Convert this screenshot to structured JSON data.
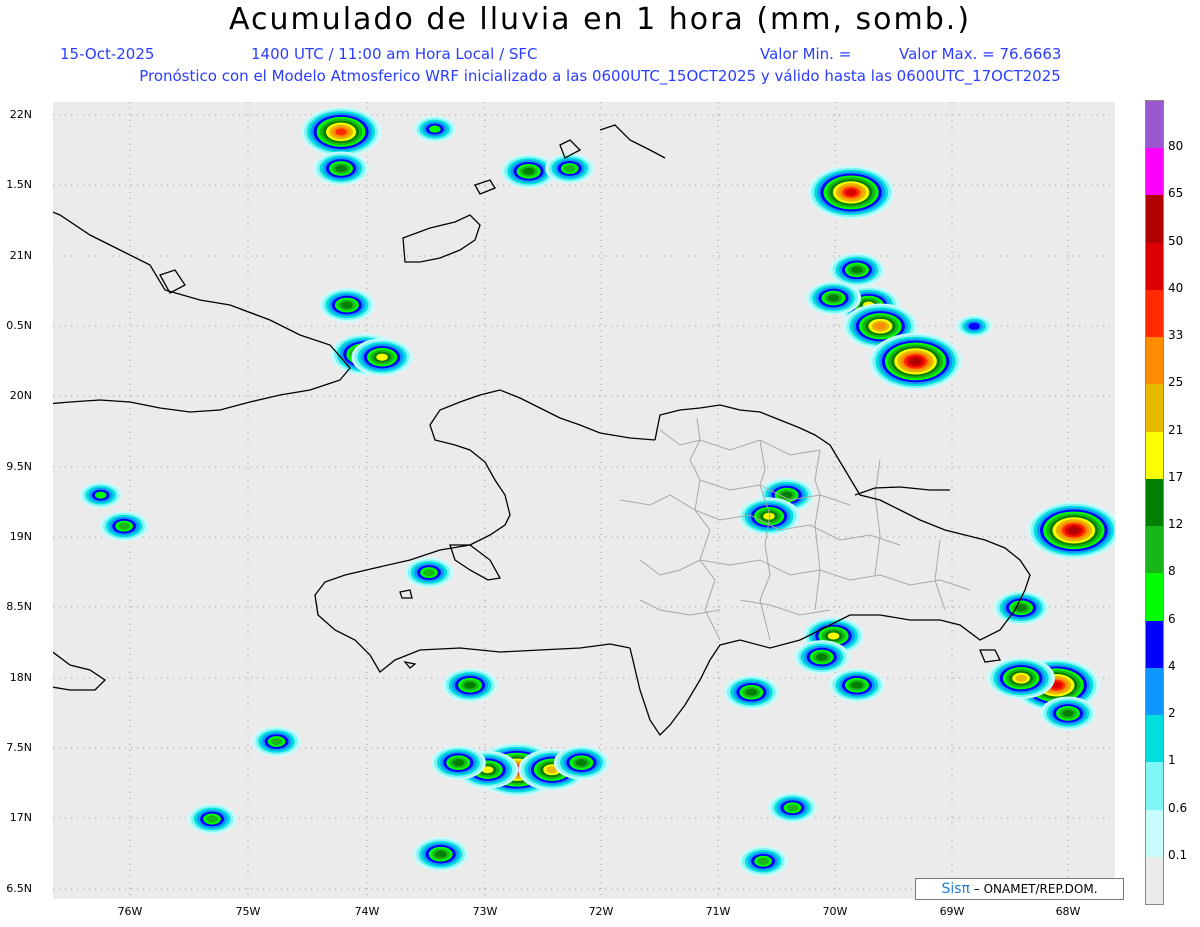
{
  "header": {
    "title": "Acumulado de lluvia en 1 hora (mm, somb.)",
    "date": "15-Oct-2025",
    "time": "1400 UTC / 11:00 am Hora Local / SFC",
    "valor_min": "Valor Min. =",
    "valor_max": "Valor Max. = 76.6663",
    "subtitle": "Pronóstico con el Modelo Atmosferico WRF inicializado a las 0600UTC_15OCT2025 y válido hasta las  0600UTC_17OCT2025"
  },
  "axes": {
    "y_labels": [
      "22N",
      "1.5N",
      "21N",
      "0.5N",
      "20N",
      "9.5N",
      "19N",
      "8.5N",
      "18N",
      "7.5N",
      "17N",
      "6.5N"
    ],
    "x_labels": [
      "76W",
      "75W",
      "74W",
      "73W",
      "72W",
      "71W",
      "70W",
      "69W",
      "68W"
    ]
  },
  "colorbar": {
    "labels": [
      "80",
      "65",
      "50",
      "40",
      "33",
      "25",
      "21",
      "17",
      "12",
      "8",
      "6",
      "4",
      "2",
      "1",
      "0.6",
      "0.1"
    ],
    "colors": [
      "#9b59d0",
      "#ff00ff",
      "#b00000",
      "#dd0000",
      "#ff2a00",
      "#ff8c00",
      "#e6b800",
      "#ffff00",
      "#008000",
      "#19b619",
      "#00ff00",
      "#0000ff",
      "#0f96ff",
      "#00dddd",
      "#7ff5f5",
      "#c8fcfc",
      "#ebebeb"
    ]
  },
  "credit": {
    "logo": "Sisπ",
    "text": "– ONAMET/REP.DOM."
  },
  "map_features": {
    "coastline_color": "#000000",
    "province_border_color": "#a8a8a8",
    "background_color": "#ebebeb"
  },
  "rain_cells": [
    {
      "lon": -74.2,
      "lat": 21.88,
      "mm": 33
    },
    {
      "lon": -74.2,
      "lat": 21.62,
      "mm": 12
    },
    {
      "lon": -73.4,
      "lat": 21.9,
      "mm": 6
    },
    {
      "lon": -72.6,
      "lat": 21.6,
      "mm": 12
    },
    {
      "lon": -72.25,
      "lat": 21.62,
      "mm": 8
    },
    {
      "lon": -74.0,
      "lat": 20.3,
      "mm": 21
    },
    {
      "lon": -73.85,
      "lat": 20.28,
      "mm": 17
    },
    {
      "lon": -74.15,
      "lat": 20.65,
      "mm": 12
    },
    {
      "lon": -69.85,
      "lat": 21.45,
      "mm": 40
    },
    {
      "lon": -69.8,
      "lat": 20.9,
      "mm": 12
    },
    {
      "lon": -69.7,
      "lat": 20.65,
      "mm": 17
    },
    {
      "lon": -69.6,
      "lat": 20.5,
      "mm": 25
    },
    {
      "lon": -69.3,
      "lat": 20.25,
      "mm": 50
    },
    {
      "lon": -70.0,
      "lat": 20.7,
      "mm": 12
    },
    {
      "lon": -72.7,
      "lat": 17.35,
      "mm": 40
    },
    {
      "lon": -72.95,
      "lat": 17.35,
      "mm": 17
    },
    {
      "lon": -72.4,
      "lat": 17.35,
      "mm": 21
    },
    {
      "lon": -72.15,
      "lat": 17.4,
      "mm": 12
    },
    {
      "lon": -73.2,
      "lat": 17.4,
      "mm": 12
    },
    {
      "lon": -68.1,
      "lat": 17.95,
      "mm": 40
    },
    {
      "lon": -68.4,
      "lat": 18.0,
      "mm": 21
    },
    {
      "lon": -67.95,
      "lat": 19.05,
      "mm": 50
    },
    {
      "lon": -70.4,
      "lat": 19.3,
      "mm": 12
    },
    {
      "lon": -70.55,
      "lat": 19.15,
      "mm": 17
    },
    {
      "lon": -70.0,
      "lat": 18.3,
      "mm": 17
    },
    {
      "lon": -70.1,
      "lat": 18.15,
      "mm": 12
    },
    {
      "lon": -69.8,
      "lat": 17.95,
      "mm": 12
    },
    {
      "lon": -70.7,
      "lat": 17.9,
      "mm": 12
    },
    {
      "lon": -68.4,
      "lat": 18.5,
      "mm": 12
    },
    {
      "lon": -73.1,
      "lat": 17.95,
      "mm": 12
    },
    {
      "lon": -74.75,
      "lat": 17.55,
      "mm": 8
    },
    {
      "lon": -75.3,
      "lat": 17.0,
      "mm": 8
    },
    {
      "lon": -73.35,
      "lat": 16.75,
      "mm": 12
    },
    {
      "lon": -70.6,
      "lat": 16.7,
      "mm": 8
    },
    {
      "lon": -70.35,
      "lat": 17.08,
      "mm": 8
    },
    {
      "lon": -73.45,
      "lat": 18.75,
      "mm": 8
    },
    {
      "lon": -76.05,
      "lat": 19.08,
      "mm": 8
    },
    {
      "lon": -76.25,
      "lat": 19.3,
      "mm": 6
    },
    {
      "lon": -68.0,
      "lat": 17.75,
      "mm": 12
    },
    {
      "lon": -68.8,
      "lat": 20.5,
      "mm": 4
    }
  ]
}
